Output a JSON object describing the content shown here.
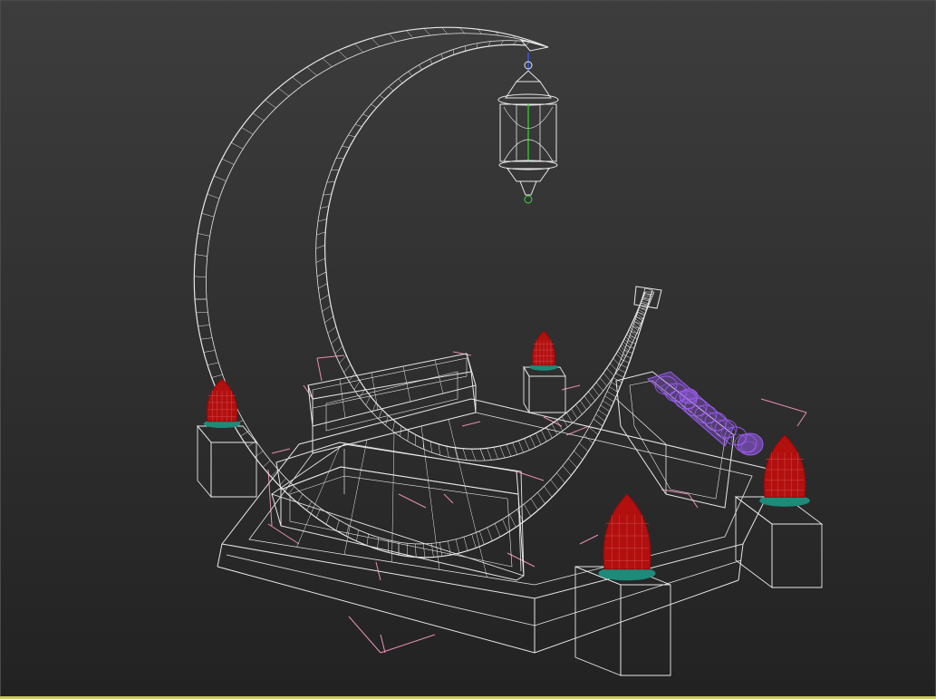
{
  "viewport": {
    "shading_mode": "wireframe",
    "background_top": "#3d3d3d",
    "background_bottom": "#222222",
    "active_border_color": "#c8c865"
  },
  "colors": {
    "wire_default": "#e8e8e8",
    "wire_selected_helpers": "#e58fb4",
    "lantern_red": "#b20f0f",
    "lantern_base": "#1e8a7a",
    "cushion_purple": "#9a5cf0",
    "pivot_green": "#3cd23c",
    "pivot_blue": "#3c5ae6"
  },
  "scene": {
    "objects": [
      {
        "name": "crescent-moon",
        "type": "wireframe-mesh"
      },
      {
        "name": "hanging-lantern",
        "type": "wireframe-mesh"
      },
      {
        "name": "platform-base",
        "type": "wireframe-mesh"
      },
      {
        "name": "bench-back",
        "type": "wireframe-mesh"
      },
      {
        "name": "bench-front",
        "type": "wireframe-mesh"
      },
      {
        "name": "bench-right",
        "type": "wireframe-mesh"
      },
      {
        "name": "cushions-purple",
        "type": "wireframe-mesh"
      },
      {
        "name": "pedestal-lanterns",
        "count": 4
      }
    ]
  }
}
